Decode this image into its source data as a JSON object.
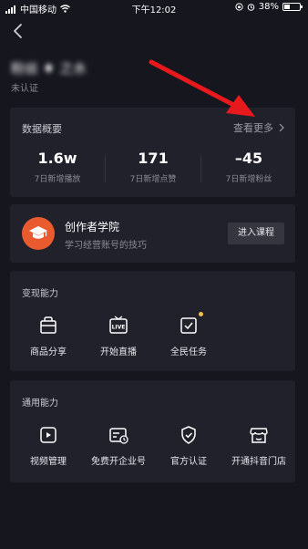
{
  "status": {
    "carrier": "中国移动",
    "time": "下午12:02",
    "battery": "38%",
    "battery_level": 0.38
  },
  "profile": {
    "name": "粉丝 ♦ 之水",
    "status": "未认证"
  },
  "overview": {
    "title": "数据概要",
    "more": "查看更多",
    "stats": [
      {
        "value": "1.6w",
        "label": "7日新增播放"
      },
      {
        "value": "171",
        "label": "7日新增点赞"
      },
      {
        "value": "–45",
        "label": "7日新增粉丝"
      }
    ]
  },
  "academy": {
    "title": "创作者学院",
    "subtitle": "学习经营账号的技巧",
    "button": "进入课程"
  },
  "monetize": {
    "title": "变现能力",
    "items": [
      {
        "label": "商品分享",
        "icon": "shop-bag-icon"
      },
      {
        "label": "开始直播",
        "icon": "live-tv-icon"
      },
      {
        "label": "全民任务",
        "icon": "task-check-icon"
      }
    ]
  },
  "general": {
    "title": "通用能力",
    "items": [
      {
        "label": "视频管理",
        "icon": "video-manage-icon"
      },
      {
        "label": "免费开企业号",
        "icon": "enterprise-icon"
      },
      {
        "label": "官方认证",
        "icon": "shield-check-icon"
      },
      {
        "label": "开通抖音门店",
        "icon": "store-icon"
      }
    ]
  },
  "colors": {
    "background": "#15161e",
    "card": "#20212b",
    "accent": "#ea5a2f",
    "notice_dot": "#f6c344",
    "annotation_arrow": "#e8191c"
  }
}
